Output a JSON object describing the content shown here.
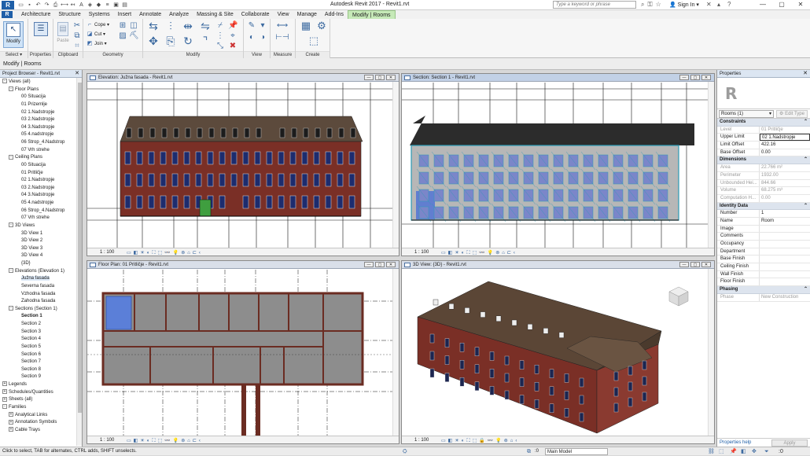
{
  "titlebar": {
    "logo": "R",
    "app_title": "Autodesk Revit 2017 -   Revit1.rvt",
    "search_placeholder": "Type a keyword or phrase",
    "sign_in": "Sign In",
    "qat_icons": [
      "open-icon",
      "save-icon",
      "undo-icon",
      "redo-icon",
      "print-icon",
      "measure-icon",
      "text-icon",
      "3d-icon",
      "section-icon",
      "thin-lines-icon",
      "close-hidden-icon",
      "switch-windows-icon"
    ]
  },
  "tabs": [
    "Architecture",
    "Structure",
    "Systems",
    "Insert",
    "Annotate",
    "Analyze",
    "Massing & Site",
    "Collaborate",
    "View",
    "Manage",
    "Add-Ins",
    "Modify | Rooms"
  ],
  "active_tab": "Modify | Rooms",
  "ribbon": {
    "select_panel": {
      "modify_label": "Modify",
      "select_label": "Select"
    },
    "properties_panel": {
      "label": "Properties"
    },
    "clipboard_panel": {
      "label": "Clipboard",
      "paste": "Paste"
    },
    "geometry_panel": {
      "label": "Geometry",
      "cope": "Cope",
      "cut": "Cut",
      "join": "Join"
    },
    "modify_panel": {
      "label": "Modify"
    },
    "view_panel": {
      "label": "View"
    },
    "measure_panel": {
      "label": "Measure"
    },
    "create_panel": {
      "label": "Create"
    }
  },
  "options_bar": {
    "context": "Modify | Rooms"
  },
  "project_browser": {
    "title": "Project Browser - Revit1.rvt",
    "nodes": [
      {
        "label": "Views (all)",
        "level": 0,
        "exp": "-"
      },
      {
        "label": "Floor Plans",
        "level": 1,
        "exp": "-"
      },
      {
        "label": "00 Situacija",
        "level": 3
      },
      {
        "label": "01 Prizemlje",
        "level": 3
      },
      {
        "label": "02 1.Nadstropje",
        "level": 3
      },
      {
        "label": "03 2.Nadstropje",
        "level": 3
      },
      {
        "label": "04 3.Nadstropje",
        "level": 3
      },
      {
        "label": "05 4.nadstropje",
        "level": 3
      },
      {
        "label": "06 Strop_4.Nadstrop",
        "level": 3
      },
      {
        "label": "07 Vrh strehe",
        "level": 3
      },
      {
        "label": "Ceiling Plans",
        "level": 1,
        "exp": "-"
      },
      {
        "label": "00 Situacija",
        "level": 3
      },
      {
        "label": "01 Pritličje",
        "level": 3
      },
      {
        "label": "02 1.Nadstropje",
        "level": 3
      },
      {
        "label": "03 2.Nadstropje",
        "level": 3
      },
      {
        "label": "04 3.Nadstropje",
        "level": 3
      },
      {
        "label": "05 4.nadstropje",
        "level": 3
      },
      {
        "label": "06 Strop_4.Nadstrop",
        "level": 3
      },
      {
        "label": "07 Vrh strehe",
        "level": 3
      },
      {
        "label": "3D Views",
        "level": 1,
        "exp": "-"
      },
      {
        "label": "3D View 1",
        "level": 3
      },
      {
        "label": "3D View 2",
        "level": 3
      },
      {
        "label": "3D View 3",
        "level": 3
      },
      {
        "label": "3D View 4",
        "level": 3
      },
      {
        "label": "{3D}",
        "level": 3
      },
      {
        "label": "Elevations (Elevation 1)",
        "level": 1,
        "exp": "-"
      },
      {
        "label": "Južna fasada",
        "level": 3,
        "sel": true
      },
      {
        "label": "Severna fasada",
        "level": 3
      },
      {
        "label": "Vzhodna fasada",
        "level": 3
      },
      {
        "label": "Zahodna fasada",
        "level": 3
      },
      {
        "label": "Sections (Section 1)",
        "level": 1,
        "exp": "-"
      },
      {
        "label": "Section 1",
        "level": 3,
        "bold": true
      },
      {
        "label": "Section 2",
        "level": 3
      },
      {
        "label": "Section 3",
        "level": 3
      },
      {
        "label": "Section 4",
        "level": 3
      },
      {
        "label": "Section 5",
        "level": 3
      },
      {
        "label": "Section 6",
        "level": 3
      },
      {
        "label": "Section 7",
        "level": 3
      },
      {
        "label": "Section 8",
        "level": 3
      },
      {
        "label": "Section 9",
        "level": 3
      },
      {
        "label": "Legends",
        "level": 0,
        "exp": "+"
      },
      {
        "label": "Schedules/Quantities",
        "level": 0,
        "exp": "+"
      },
      {
        "label": "Sheets (all)",
        "level": 0,
        "exp": "+"
      },
      {
        "label": "Families",
        "level": 0,
        "exp": "-"
      },
      {
        "label": "Analytical Links",
        "level": 1,
        "exp": "+"
      },
      {
        "label": "Annotation Symbols",
        "level": 1,
        "exp": "+"
      },
      {
        "label": "Cable Trays",
        "level": 1,
        "exp": "+"
      }
    ]
  },
  "views": {
    "elevation": {
      "title": "Elevation: Južna fasada - Revit1.rvt",
      "scale": "1 : 100"
    },
    "section": {
      "title": "Section: Section 1 - Revit1.rvt",
      "scale": "1 : 100"
    },
    "floorplan": {
      "title": "Floor Plan: 01 Pritličje - Revit1.rvt",
      "scale": "1 : 100"
    },
    "threed": {
      "title": "3D View: {3D} - Revit1.rvt",
      "scale": "1 : 100"
    }
  },
  "properties": {
    "title": "Properties",
    "type_selector": "Rooms (1)",
    "edit_type": "Edit Type",
    "sections": [
      {
        "name": "Constraints",
        "rows": [
          {
            "k": "Level",
            "v": "01 Pritličje",
            "dim": true
          },
          {
            "k": "Upper Limit",
            "v": "02 1.Nadstropje",
            "edit": true
          },
          {
            "k": "Limit Offset",
            "v": "422.16"
          },
          {
            "k": "Base Offset",
            "v": "0.00"
          }
        ]
      },
      {
        "name": "Dimensions",
        "rows": [
          {
            "k": "Area",
            "v": "22.766 m²",
            "dim": true
          },
          {
            "k": "Perimeter",
            "v": "1932.00",
            "dim": true
          },
          {
            "k": "Unbounded Hei...",
            "v": "844.66",
            "dim": true
          },
          {
            "k": "Volume",
            "v": "68.275 m³",
            "dim": true
          },
          {
            "k": "Computation H...",
            "v": "0.00",
            "dim": true
          }
        ]
      },
      {
        "name": "Identity Data",
        "rows": [
          {
            "k": "Number",
            "v": "1"
          },
          {
            "k": "Name",
            "v": "Room"
          },
          {
            "k": "Image",
            "v": ""
          },
          {
            "k": "Comments",
            "v": ""
          },
          {
            "k": "Occupancy",
            "v": ""
          },
          {
            "k": "Department",
            "v": ""
          },
          {
            "k": "Base Finish",
            "v": ""
          },
          {
            "k": "Ceiling Finish",
            "v": ""
          },
          {
            "k": "Wall Finish",
            "v": ""
          },
          {
            "k": "Floor Finish",
            "v": ""
          }
        ]
      },
      {
        "name": "Phasing",
        "rows": [
          {
            "k": "Phase",
            "v": "New Construction",
            "dim": true
          }
        ]
      }
    ],
    "help_link": "Properties help",
    "apply": "Apply"
  },
  "status_bar": {
    "hint": "Click to select, TAB for alternates, CTRL adds, SHIFT unselects.",
    "workset_value": ":0",
    "model": "Main Model"
  },
  "colors": {
    "brick": "#7a2f26",
    "roof": "#5a4a3a",
    "context_tab": "#c6e9b8",
    "section_cut": "#2a9bb5"
  }
}
